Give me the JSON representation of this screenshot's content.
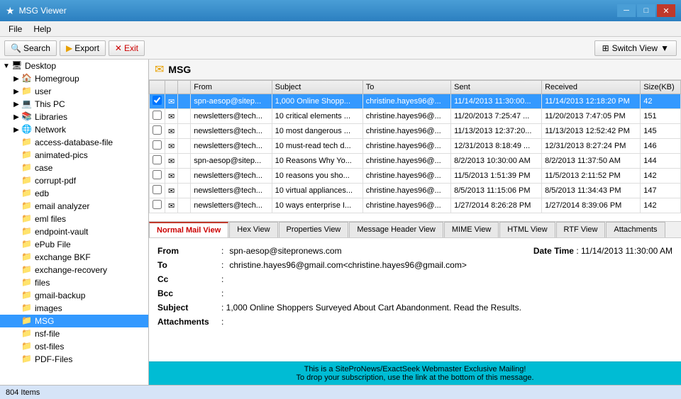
{
  "app": {
    "title": "MSG Viewer",
    "icon": "★"
  },
  "titlebar": {
    "minimize": "─",
    "maximize": "□",
    "close": "✕"
  },
  "menu": {
    "items": [
      "File",
      "Help"
    ]
  },
  "toolbar": {
    "search_label": "Search",
    "export_label": "Export",
    "exit_label": "Exit",
    "switch_view_label": "Switch View"
  },
  "sidebar": {
    "items": [
      {
        "id": "desktop",
        "label": "Desktop",
        "indent": 1,
        "arrow": "▼",
        "icon": "🖥",
        "expanded": true
      },
      {
        "id": "homegroup",
        "label": "Homegroup",
        "indent": 2,
        "arrow": "▶",
        "icon": "🏠",
        "expanded": false
      },
      {
        "id": "user",
        "label": "user",
        "indent": 2,
        "arrow": "▶",
        "icon": "📁",
        "expanded": false
      },
      {
        "id": "thispc",
        "label": "This PC",
        "indent": 2,
        "arrow": "▶",
        "icon": "💻",
        "expanded": false
      },
      {
        "id": "libraries",
        "label": "Libraries",
        "indent": 2,
        "arrow": "▶",
        "icon": "📚",
        "expanded": false
      },
      {
        "id": "network",
        "label": "Network",
        "indent": 2,
        "arrow": "▶",
        "icon": "🌐",
        "expanded": false
      },
      {
        "id": "access-database-file",
        "label": "access-database-file",
        "indent": 2,
        "arrow": "",
        "icon": "📁",
        "expanded": false
      },
      {
        "id": "animated-pics",
        "label": "animated-pics",
        "indent": 2,
        "arrow": "",
        "icon": "📁",
        "expanded": false
      },
      {
        "id": "case",
        "label": "case",
        "indent": 2,
        "arrow": "",
        "icon": "📁",
        "expanded": false
      },
      {
        "id": "corrupt-pdf",
        "label": "corrupt-pdf",
        "indent": 2,
        "arrow": "",
        "icon": "📁",
        "expanded": false
      },
      {
        "id": "edb",
        "label": "edb",
        "indent": 2,
        "arrow": "",
        "icon": "📁",
        "expanded": false
      },
      {
        "id": "email-analyzer",
        "label": "email analyzer",
        "indent": 2,
        "arrow": "",
        "icon": "📁",
        "expanded": false
      },
      {
        "id": "eml-files",
        "label": "eml files",
        "indent": 2,
        "arrow": "",
        "icon": "📁",
        "expanded": false
      },
      {
        "id": "endpoint-vault",
        "label": "endpoint-vault",
        "indent": 2,
        "arrow": "",
        "icon": "📁",
        "expanded": false
      },
      {
        "id": "epub-file",
        "label": "ePub File",
        "indent": 2,
        "arrow": "",
        "icon": "📁",
        "expanded": false
      },
      {
        "id": "exchange-bkf",
        "label": "exchange BKF",
        "indent": 2,
        "arrow": "",
        "icon": "📁",
        "expanded": false
      },
      {
        "id": "exchange-recovery",
        "label": "exchange-recovery",
        "indent": 2,
        "arrow": "",
        "icon": "📁",
        "expanded": false
      },
      {
        "id": "files",
        "label": "files",
        "indent": 2,
        "arrow": "",
        "icon": "📁",
        "expanded": false
      },
      {
        "id": "gmail-backup",
        "label": "gmail-backup",
        "indent": 2,
        "arrow": "",
        "icon": "📁",
        "expanded": false
      },
      {
        "id": "images",
        "label": "images",
        "indent": 2,
        "arrow": "",
        "icon": "📁",
        "expanded": false
      },
      {
        "id": "msg",
        "label": "MSG",
        "indent": 2,
        "arrow": "",
        "icon": "📁",
        "expanded": false,
        "selected": true
      },
      {
        "id": "nsf-file",
        "label": "nsf-file",
        "indent": 2,
        "arrow": "",
        "icon": "📁",
        "expanded": false
      },
      {
        "id": "ost-files",
        "label": "ost-files",
        "indent": 2,
        "arrow": "",
        "icon": "📁",
        "expanded": false
      },
      {
        "id": "pdf-files",
        "label": "PDF-Files",
        "indent": 2,
        "arrow": "",
        "icon": "📁",
        "expanded": false
      }
    ]
  },
  "msg_panel": {
    "title": "MSG",
    "icon": "✉"
  },
  "email_table": {
    "columns": [
      "",
      "",
      "",
      "From",
      "Subject",
      "To",
      "Sent",
      "Received",
      "Size(KB)"
    ],
    "rows": [
      {
        "selected": true,
        "from": "spn-aesop@sitep...",
        "subject": "1,000 Online Shopp...",
        "to": "christine.hayes96@...",
        "sent": "11/14/2013 11:30:00...",
        "received": "11/14/2013 12:18:20 PM",
        "size": "42"
      },
      {
        "selected": false,
        "from": "newsletters@tech...",
        "subject": "10 critical elements ...",
        "to": "christine.hayes96@...",
        "sent": "11/20/2013 7:25:47 ...",
        "received": "11/20/2013 7:47:05 PM",
        "size": "151"
      },
      {
        "selected": false,
        "from": "newsletters@tech...",
        "subject": "10 most dangerous ...",
        "to": "christine.hayes96@...",
        "sent": "11/13/2013 12:37:20...",
        "received": "11/13/2013 12:52:42 PM",
        "size": "145"
      },
      {
        "selected": false,
        "from": "newsletters@tech...",
        "subject": "10 must-read tech d...",
        "to": "christine.hayes96@...",
        "sent": "12/31/2013 8:18:49 ...",
        "received": "12/31/2013 8:27:24 PM",
        "size": "146"
      },
      {
        "selected": false,
        "from": "spn-aesop@sitep...",
        "subject": "10 Reasons Why Yo...",
        "to": "christine.hayes96@...",
        "sent": "8/2/2013 10:30:00 AM",
        "received": "8/2/2013 11:37:50 AM",
        "size": "144"
      },
      {
        "selected": false,
        "from": "newsletters@tech...",
        "subject": "10 reasons you sho...",
        "to": "christine.hayes96@...",
        "sent": "11/5/2013 1:51:39 PM",
        "received": "11/5/2013 2:11:52 PM",
        "size": "142"
      },
      {
        "selected": false,
        "from": "newsletters@tech...",
        "subject": "10 virtual appliances...",
        "to": "christine.hayes96@...",
        "sent": "8/5/2013 11:15:06 PM",
        "received": "8/5/2013 11:34:43 PM",
        "size": "147"
      },
      {
        "selected": false,
        "from": "newsletters@tech...",
        "subject": "10 ways enterprise I...",
        "to": "christine.hayes96@...",
        "sent": "1/27/2014 8:26:28 PM",
        "received": "1/27/2014 8:39:06 PM",
        "size": "142"
      }
    ]
  },
  "view_tabs": [
    {
      "id": "normal",
      "label": "Normal Mail View",
      "active": true
    },
    {
      "id": "hex",
      "label": "Hex View",
      "active": false
    },
    {
      "id": "properties",
      "label": "Properties View",
      "active": false
    },
    {
      "id": "header",
      "label": "Message Header View",
      "active": false
    },
    {
      "id": "mime",
      "label": "MIME View",
      "active": false
    },
    {
      "id": "html",
      "label": "HTML View",
      "active": false
    },
    {
      "id": "rtf",
      "label": "RTF View",
      "active": false
    },
    {
      "id": "attachments",
      "label": "Attachments",
      "active": false
    }
  ],
  "email_detail": {
    "from_label": "From",
    "from_value": "spn-aesop@sitepronews.com",
    "datetime_label": "Date Time",
    "datetime_value": ": 11/14/2013 11:30:00 AM",
    "to_label": "To",
    "to_value": "christine.hayes96@gmail.com<christine.hayes96@gmail.com>",
    "cc_label": "Cc",
    "cc_value": ":",
    "bcc_label": "Bcc",
    "bcc_value": ":",
    "subject_label": "Subject",
    "subject_value": ": 1,000 Online Shoppers Surveyed About Cart Abandonment. Read the Results.",
    "attachments_label": "Attachments",
    "attachments_value": ":"
  },
  "preview": {
    "line1": "This is a SiteProNews/ExactSeek Webmaster Exclusive Mailing!",
    "line2": "To drop your subscription, use the link at the bottom of this message."
  },
  "status_bar": {
    "text": "804 Items"
  }
}
